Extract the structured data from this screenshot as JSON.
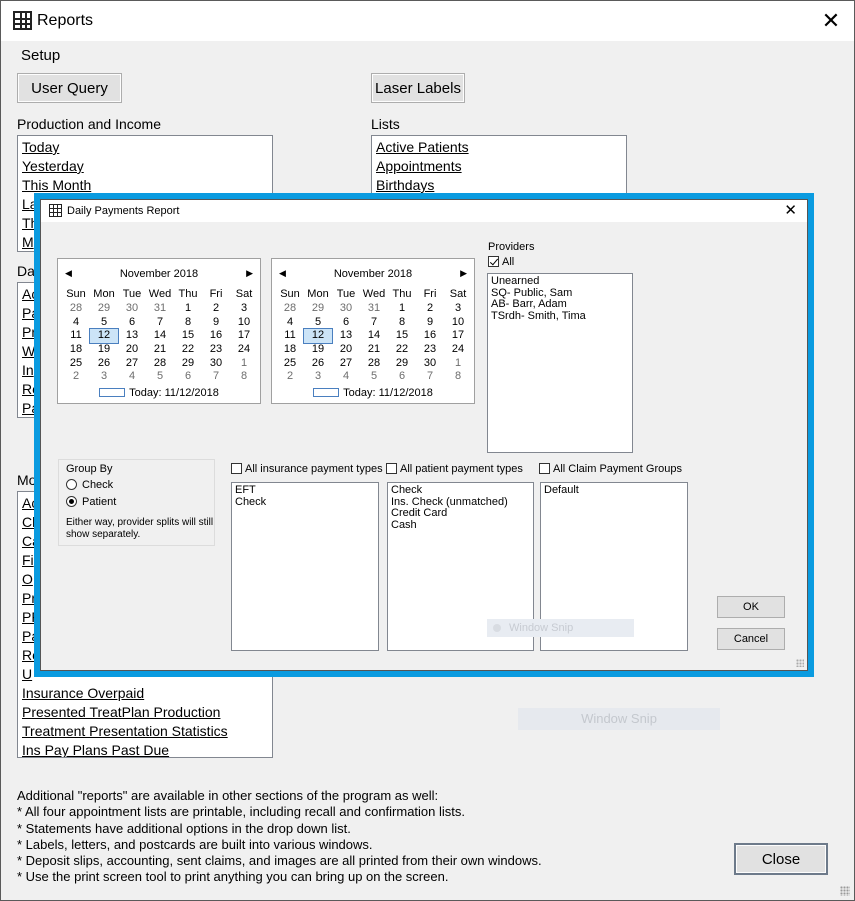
{
  "window": {
    "title": "Reports",
    "close_glyph": "✕"
  },
  "menu": {
    "setup": "Setup"
  },
  "buttons": {
    "user_query": "User Query",
    "laser_labels": "Laser Labels",
    "close": "Close"
  },
  "production": {
    "label": "Production and Income",
    "items": [
      "Today",
      "Yesterday",
      "This Month",
      "La",
      "Th",
      "M"
    ]
  },
  "lists": {
    "label": "Lists",
    "items": [
      "Active Patients",
      "Appointments",
      "Birthdays"
    ]
  },
  "daily": {
    "label": "Da",
    "items": [
      "Ac",
      "Pa",
      "Pr",
      "W",
      "In",
      "Re",
      "Pa"
    ]
  },
  "monthly": {
    "label": "Mo",
    "items": [
      "Ac",
      "Cl",
      "Ca",
      "Fi",
      "O",
      "Pr",
      "PF",
      "Pa",
      "Re",
      "U",
      "Insurance Overpaid",
      "Presented TreatPlan Production",
      "Treatment Presentation Statistics",
      "Ins Pay Plans Past Due"
    ]
  },
  "notes": [
    "Additional \"reports\" are available in other sections of the program as well:",
    "* All four appointment lists are printable, including recall and confirmation lists.",
    "* Statements have additional options in the drop down list.",
    "* Labels, letters, and postcards are built into various windows.",
    "* Deposit slips, accounting, sent claims, and images are all printed from their own windows.",
    "* Use the print screen tool to print anything you can bring up on the screen."
  ],
  "ghost_snip": "Window Snip",
  "dialog": {
    "title": "Daily Payments Report",
    "close_glyph": "✕",
    "calendar_left": {
      "month": "November 2018",
      "dow": [
        "Sun",
        "Mon",
        "Tue",
        "Wed",
        "Thu",
        "Fri",
        "Sat"
      ],
      "weeks": [
        [
          "28",
          "29",
          "30",
          "31",
          "1",
          "2",
          "3"
        ],
        [
          "4",
          "5",
          "6",
          "7",
          "8",
          "9",
          "10"
        ],
        [
          "11",
          "12",
          "13",
          "14",
          "15",
          "16",
          "17"
        ],
        [
          "18",
          "19",
          "20",
          "21",
          "22",
          "23",
          "24"
        ],
        [
          "25",
          "26",
          "27",
          "28",
          "29",
          "30",
          "1"
        ],
        [
          "2",
          "3",
          "4",
          "5",
          "6",
          "7",
          "8"
        ]
      ],
      "selected": "12",
      "today_label": "Today: 11/12/2018"
    },
    "calendar_right": {
      "month": "November 2018",
      "today_label": "Today: 11/12/2018"
    },
    "providers": {
      "label": "Providers",
      "all_label": "All",
      "all_checked": true,
      "items": [
        "Unearned",
        "SQ- Public, Sam",
        "AB- Barr, Adam",
        "TSrdh- Smith, Tima"
      ]
    },
    "group_by": {
      "label": "Group By",
      "options": [
        "Check",
        "Patient"
      ],
      "selected": "Patient",
      "note": "Either way, provider splits will still show separately."
    },
    "insurance": {
      "label": "All insurance payment types",
      "items": [
        "EFT",
        "Check"
      ]
    },
    "patient": {
      "label": "All patient payment types",
      "items": [
        "Check",
        "Ins. Check (unmatched)",
        "Credit Card",
        "Cash"
      ]
    },
    "claim": {
      "label": "All Claim Payment Groups",
      "items": [
        "Default"
      ]
    },
    "ok": "OK",
    "cancel": "Cancel",
    "ghost_snip": "Window Snip"
  }
}
